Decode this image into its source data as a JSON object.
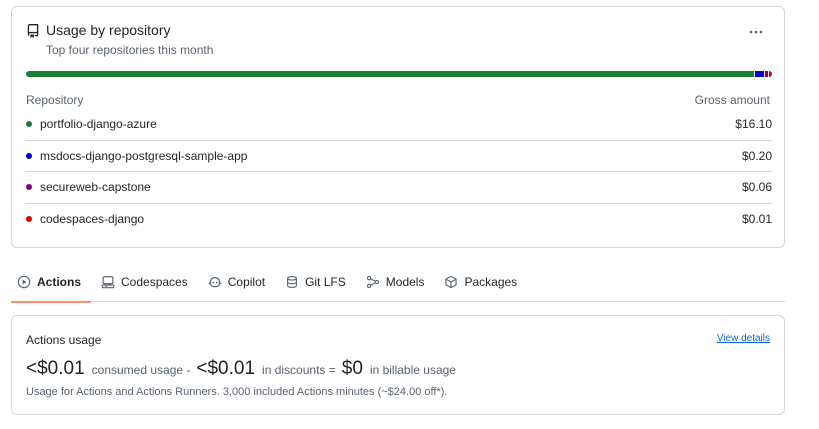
{
  "usage_card": {
    "title": "Usage by repository",
    "subtitle": "Top four repositories this month",
    "more_icon": "kebab-horizontal-icon",
    "repo_icon": "repo-icon",
    "col_repository": "Repository",
    "col_amount": "Gross amount",
    "repositories": [
      {
        "name": "portfolio-django-azure",
        "amount": "$16.10",
        "value": 16.1,
        "color": "#1a7f37"
      },
      {
        "name": "msdocs-django-postgresql-sample-app",
        "amount": "$0.20",
        "value": 0.2,
        "color": "#0000cc"
      },
      {
        "name": "secureweb-capstone",
        "amount": "$0.06",
        "value": 0.06,
        "color": "#800080"
      },
      {
        "name": "codespaces-django",
        "amount": "$0.01",
        "value": 0.01,
        "color": "#dd0000"
      }
    ]
  },
  "tabs": [
    {
      "label": "Actions",
      "icon": "play-icon",
      "active": true
    },
    {
      "label": "Codespaces",
      "icon": "codespaces-icon",
      "active": false
    },
    {
      "label": "Copilot",
      "icon": "copilot-icon",
      "active": false
    },
    {
      "label": "Git LFS",
      "icon": "database-icon",
      "active": false
    },
    {
      "label": "Models",
      "icon": "models-icon",
      "active": false
    },
    {
      "label": "Packages",
      "icon": "package-icon",
      "active": false
    }
  ],
  "actions_card": {
    "title": "Actions usage",
    "view_details": "View details",
    "consumed_value": "<$0.01",
    "consumed_label": "consumed usage -",
    "discount_value": "<$0.01",
    "discount_label": "in discounts =",
    "billable_value": "$0",
    "billable_label": "in billable usage",
    "footnote": "Usage for Actions and Actions Runners. 3,000 included Actions minutes (~$24.00 off*)."
  }
}
